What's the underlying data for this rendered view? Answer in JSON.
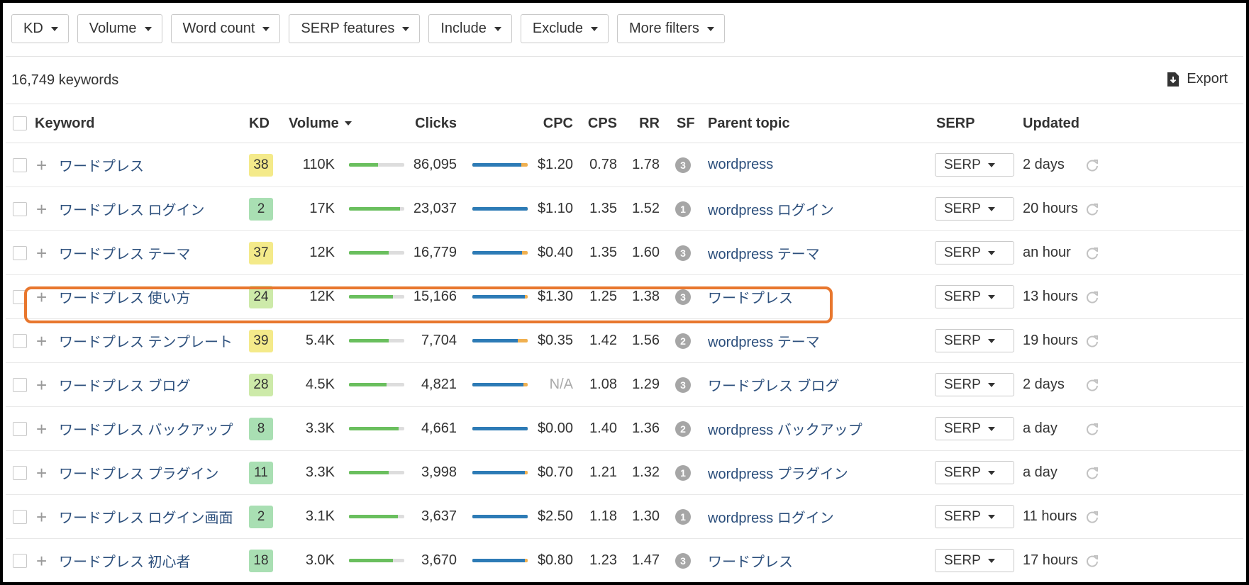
{
  "filters": [
    "KD",
    "Volume",
    "Word count",
    "SERP features",
    "Include",
    "Exclude",
    "More filters"
  ],
  "summary": "16,749 keywords",
  "export_label": "Export",
  "columns": {
    "keyword": "Keyword",
    "kd": "KD",
    "volume": "Volume",
    "clicks": "Clicks",
    "cpc": "CPC",
    "cps": "CPS",
    "rr": "RR",
    "sf": "SF",
    "parent": "Parent topic",
    "serp": "SERP",
    "updated": "Updated"
  },
  "colors": {
    "kd_green": "#a9dfb3",
    "kd_yellow": "#f4ea8a",
    "kd_lightgreen": "#cdeaa9",
    "highlight": "#e8772e",
    "link": "#2c4f7c"
  },
  "rows": [
    {
      "keyword": "ワードプレス",
      "kd": "38",
      "kd_color": "#f4ea8a",
      "volume": "110K",
      "vol_fill": 0.52,
      "clicks": "86,095",
      "click_fill": 0.88,
      "cpc": "$1.20",
      "cps": "0.78",
      "rr": "1.78",
      "sf": "3",
      "parent": "wordpress",
      "serp": "SERP",
      "updated": "2 days"
    },
    {
      "keyword": "ワードプレス ログイン",
      "kd": "2",
      "kd_color": "#a9dfb3",
      "volume": "17K",
      "vol_fill": 0.92,
      "clicks": "23,037",
      "click_fill": 1.0,
      "cpc": "$1.10",
      "cps": "1.35",
      "rr": "1.52",
      "sf": "1",
      "parent": "wordpress ログイン",
      "serp": "SERP",
      "updated": "20 hours"
    },
    {
      "keyword": "ワードプレス テーマ",
      "kd": "37",
      "kd_color": "#f4ea8a",
      "volume": "12K",
      "vol_fill": 0.72,
      "clicks": "16,779",
      "click_fill": 0.9,
      "cpc": "$0.40",
      "cps": "1.35",
      "rr": "1.60",
      "sf": "3",
      "parent": "wordpress テーマ",
      "serp": "SERP",
      "updated": "an hour"
    },
    {
      "keyword": "ワードプレス 使い方",
      "kd": "24",
      "kd_color": "#cdeaa9",
      "volume": "12K",
      "vol_fill": 0.8,
      "clicks": "15,166",
      "click_fill": 0.95,
      "cpc": "$1.30",
      "cps": "1.25",
      "rr": "1.38",
      "sf": "3",
      "parent": "ワードプレス",
      "serp": "SERP",
      "updated": "13 hours"
    },
    {
      "keyword": "ワードプレス テンプレート",
      "kd": "39",
      "kd_color": "#f4ea8a",
      "volume": "5.4K",
      "vol_fill": 0.72,
      "clicks": "7,704",
      "click_fill": 0.82,
      "cpc": "$0.35",
      "cps": "1.42",
      "rr": "1.56",
      "sf": "2",
      "parent": "wordpress テーマ",
      "serp": "SERP",
      "updated": "19 hours"
    },
    {
      "keyword": "ワードプレス ブログ",
      "kd": "28",
      "kd_color": "#cdeaa9",
      "volume": "4.5K",
      "vol_fill": 0.68,
      "clicks": "4,821",
      "click_fill": 0.92,
      "cpc": "N/A",
      "cps": "1.08",
      "rr": "1.29",
      "sf": "3",
      "parent": "ワードプレス ブログ",
      "serp": "SERP",
      "updated": "2 days"
    },
    {
      "keyword": "ワードプレス バックアップ",
      "kd": "8",
      "kd_color": "#a9dfb3",
      "volume": "3.3K",
      "vol_fill": 0.9,
      "clicks": "4,661",
      "click_fill": 1.0,
      "cpc": "$0.00",
      "cps": "1.40",
      "rr": "1.36",
      "sf": "2",
      "parent": "wordpress バックアップ",
      "serp": "SERP",
      "updated": "a day"
    },
    {
      "keyword": "ワードプレス プラグイン",
      "kd": "11",
      "kd_color": "#a9dfb3",
      "volume": "3.3K",
      "vol_fill": 0.72,
      "clicks": "3,998",
      "click_fill": 0.95,
      "cpc": "$0.70",
      "cps": "1.21",
      "rr": "1.32",
      "sf": "1",
      "parent": "wordpress プラグイン",
      "serp": "SERP",
      "updated": "a day"
    },
    {
      "keyword": "ワードプレス ログイン画面",
      "kd": "2",
      "kd_color": "#a9dfb3",
      "volume": "3.1K",
      "vol_fill": 0.88,
      "clicks": "3,637",
      "click_fill": 1.0,
      "cpc": "$2.50",
      "cps": "1.18",
      "rr": "1.30",
      "sf": "1",
      "parent": "wordpress ログイン",
      "serp": "SERP",
      "updated": "11 hours"
    },
    {
      "keyword": "ワードプレス 初心者",
      "kd": "18",
      "kd_color": "#a9dfb3",
      "volume": "3.0K",
      "vol_fill": 0.8,
      "clicks": "3,670",
      "click_fill": 0.95,
      "cpc": "$0.80",
      "cps": "1.23",
      "rr": "1.47",
      "sf": "3",
      "parent": "ワードプレス",
      "serp": "SERP",
      "updated": "17 hours"
    }
  ],
  "highlighted_row": 4
}
